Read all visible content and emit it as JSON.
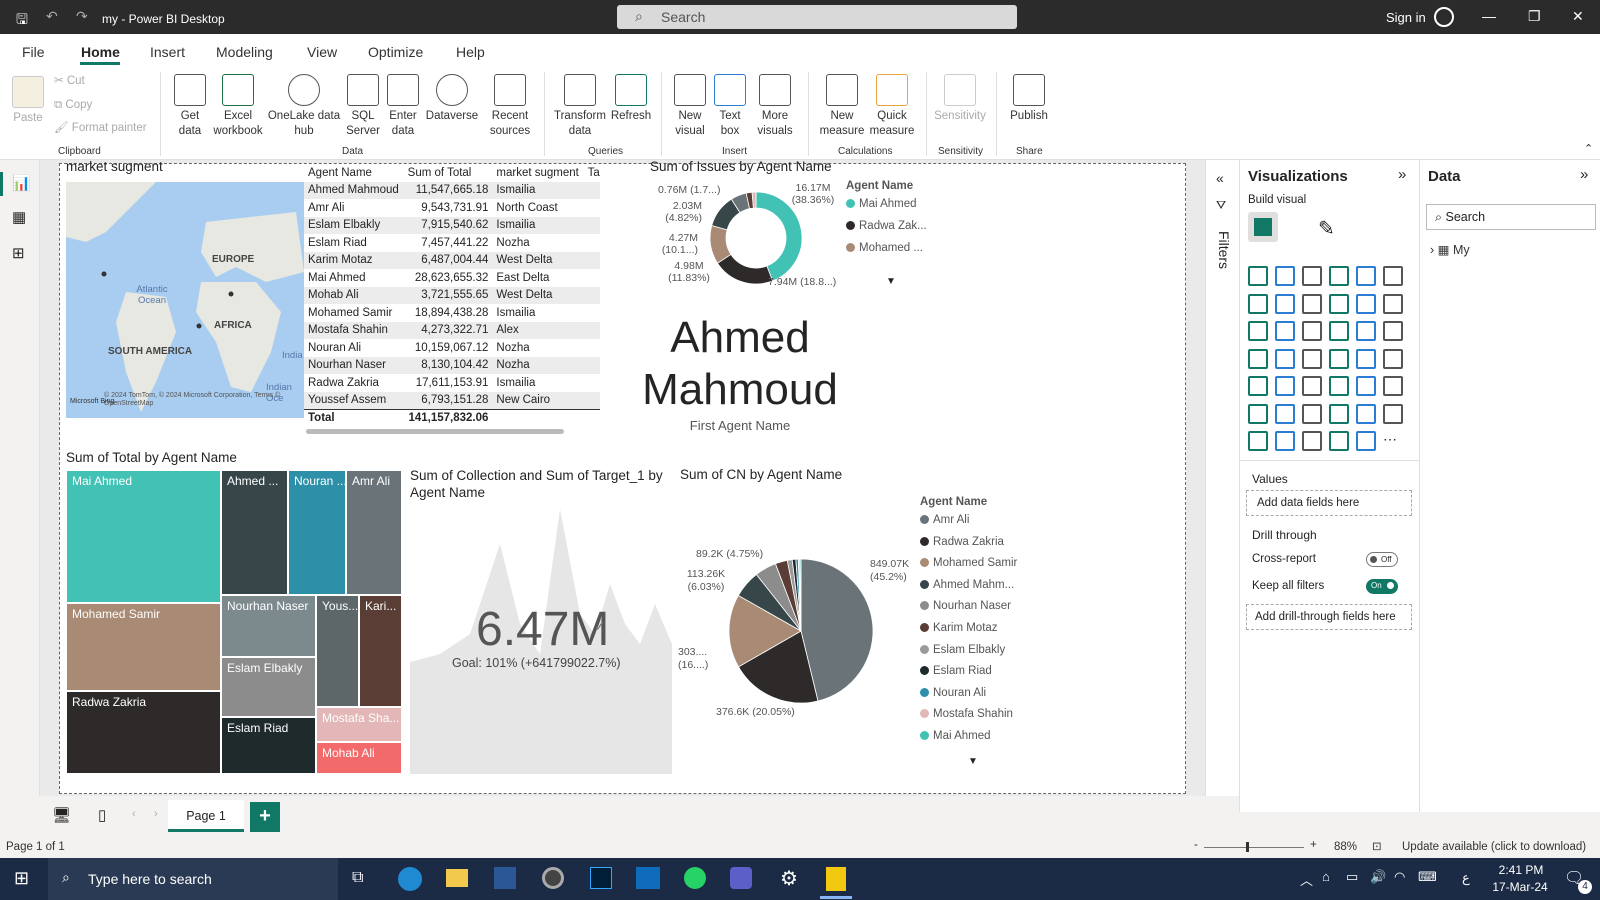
{
  "window": {
    "title": "my - Power BI Desktop",
    "search_placeholder": "Search",
    "signin": "Sign in"
  },
  "menu": [
    "File",
    "Home",
    "Insert",
    "Modeling",
    "View",
    "Optimize",
    "Help"
  ],
  "ribbon": {
    "clipboard": {
      "paste": "Paste",
      "cut": "Cut",
      "copy": "Copy",
      "format_painter": "Format painter",
      "group": "Clipboard"
    },
    "data": {
      "get_data": "Get data",
      "excel": "Excel workbook",
      "onelake": "OneLake data hub",
      "sql": "SQL Server",
      "enter": "Enter data",
      "dataverse": "Dataverse",
      "recent": "Recent sources",
      "group": "Data"
    },
    "queries": {
      "transform": "Transform data",
      "refresh": "Refresh",
      "group": "Queries"
    },
    "insert": {
      "new_visual": "New visual",
      "text_box": "Text box",
      "more_visuals": "More visuals",
      "group": "Insert"
    },
    "calculations": {
      "new_measure": "New measure",
      "quick_measure": "Quick measure",
      "group": "Calculations"
    },
    "sensitivity": {
      "label": "Sensitivity",
      "group": "Sensitivity"
    },
    "share": {
      "publish": "Publish",
      "group": "Share"
    }
  },
  "map": {
    "title": "market sugment",
    "labels": {
      "europe": "EUROPE",
      "africa": "AFRICA",
      "south_america": "SOUTH AMERICA",
      "atlantic": "Atlantic Ocean",
      "india": "India",
      "indian": "Indian Oce"
    },
    "credits": "© 2024 TomTom, © 2024 Microsoft Corporation, Terms © OpenStreetMap",
    "bing": "Microsoft Bing"
  },
  "table": {
    "headers": [
      "Agent Name",
      "Sum of Total",
      "market sugment",
      "Ta"
    ],
    "rows": [
      [
        "Ahmed Mahmoud",
        "11,547,665.18",
        "Ismailia"
      ],
      [
        "Amr Ali",
        "9,543,731.91",
        "North Coast"
      ],
      [
        "Eslam Elbakly",
        "7,915,540.62",
        "Ismailia"
      ],
      [
        "Eslam Riad",
        "7,457,441.22",
        "Nozha"
      ],
      [
        "Karim Motaz",
        "6,487,004.44",
        "West Delta"
      ],
      [
        "Mai Ahmed",
        "28,623,655.32",
        "East Delta"
      ],
      [
        "Mohab Ali",
        "3,721,555.65",
        "West Delta"
      ],
      [
        "Mohamed Samir",
        "18,894,438.28",
        "Ismailia"
      ],
      [
        "Mostafa Shahin",
        "4,273,322.71",
        "Alex"
      ],
      [
        "Nouran Ali",
        "10,159,067.12",
        "Nozha"
      ],
      [
        "Nourhan Naser",
        "8,130,104.42",
        "Nozha"
      ],
      [
        "Radwa Zakria",
        "17,611,153.91",
        "Ismailia"
      ],
      [
        "Youssef Assem",
        "6,793,151.28",
        "New Cairo"
      ]
    ],
    "total_label": "Total",
    "total_value": "141,157,832.06"
  },
  "donut": {
    "title": "Sum of Issues by Agent Name",
    "legend_title": "Agent Name",
    "legend": [
      "Mai Ahmed",
      "Radwa Zak...",
      "Mohamed ..."
    ],
    "labels": {
      "a": "0.76M (1.7...)",
      "b": "2.03M (4.82%)",
      "c": "4.27M (10.1...)",
      "d": "4.98M (11.83%)",
      "e": "7.94M (18.8...)",
      "f": "16.17M (38.36%)"
    }
  },
  "card": {
    "value_line1": "Ahmed",
    "value_line2": "Mahmoud",
    "label": "First Agent Name"
  },
  "treemap": {
    "title": "Sum of Total by Agent Name",
    "tiles": [
      "Mai Ahmed",
      "Ahmed ...",
      "Nouran ...",
      "Amr Ali",
      "Mohamed Samir",
      "Nourhan Naser",
      "Yous...",
      "Kari...",
      "Eslam Elbakly",
      "Radwa Zakria",
      "Eslam Riad",
      "Mostafa Sha...",
      "Mohab Ali"
    ]
  },
  "kpi": {
    "title": "Sum of Collection and Sum of Target_1 by Agent Name",
    "value": "6.47M",
    "goal": "Goal: 101% (+641799022.7%)"
  },
  "pie": {
    "title": "Sum of CN by Agent Name",
    "legend_title": "Agent Name",
    "legend": [
      "Amr Ali",
      "Radwa Zakria",
      "Mohamed Samir",
      "Ahmed Mahm...",
      "Nourhan Naser",
      "Karim Motaz",
      "Eslam Elbakly",
      "Eslam Riad",
      "Nouran Ali",
      "Mostafa Shahin",
      "Mai Ahmed"
    ],
    "labels": {
      "a": "849.07K (45.2%)",
      "b": "376.6K (20.05%)",
      "c": "303.... (16....)",
      "d": "113.26K (6.03%)",
      "e": "89.2K (4.75%)"
    }
  },
  "filters": {
    "label": "Filters"
  },
  "viz": {
    "title": "Visualizations",
    "build": "Build visual",
    "values": "Values",
    "add_data": "Add data fields here",
    "drill": "Drill through",
    "cross": "Cross-report",
    "cross_state": "Off",
    "keep": "Keep all filters",
    "keep_state": "On",
    "add_drill": "Add drill-through fields here"
  },
  "data_pane": {
    "title": "Data",
    "search": "Search",
    "item": "My"
  },
  "pages": {
    "tab": "Page 1",
    "add": "+"
  },
  "status": {
    "page": "Page 1 of 1",
    "zoom": "88%",
    "update": "Update available (click to download)"
  },
  "taskbar": {
    "search": "Type here to search",
    "time": "2:41 PM",
    "date": "17-Mar-24",
    "lang": "ع",
    "notif": "4"
  },
  "chart_data": [
    {
      "type": "pie",
      "title": "Sum of Issues by Agent Name",
      "labels": [
        "Mai Ahmed",
        "Radwa Zakria",
        "Mohamed Samir",
        "",
        "",
        "",
        ""
      ],
      "values": [
        16.17,
        7.94,
        4.98,
        4.27,
        2.03,
        0.76,
        0.5
      ],
      "unit": "M"
    },
    {
      "type": "pie",
      "title": "Sum of CN by Agent Name",
      "labels": [
        "Amr Ali",
        "Radwa Zakria",
        "Mohamed Samir",
        "Ahmed Mahmoud",
        "Nourhan Naser",
        "Karim Motaz",
        "Eslam Elbakly",
        "Eslam Riad",
        "Nouran Ali",
        "Mostafa Shahin",
        "Mai Ahmed"
      ],
      "values": [
        849.07,
        376.6,
        303,
        113.26,
        89.2,
        50,
        20,
        15,
        10,
        6,
        5
      ],
      "unit": "K"
    }
  ],
  "colors": {
    "teal": "#41c2b4",
    "dark": "#2f2a2a",
    "brown": "#a98a74",
    "slate": "#374649",
    "blue": "#2d8fa8",
    "gray": "#6a7478",
    "pink": "#e8a8a8",
    "red": "#f26a6a",
    "mid": "#8c8c8c",
    "darkred": "#5a3d35"
  }
}
